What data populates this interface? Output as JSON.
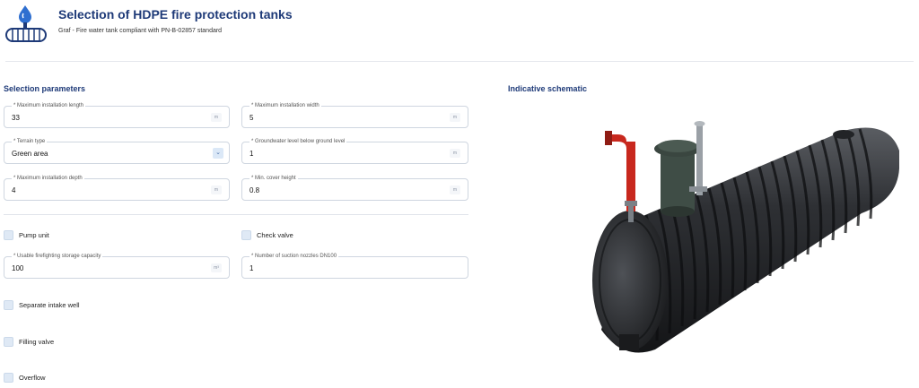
{
  "header": {
    "title": "Selection of HDPE fire protection tanks",
    "subtitle": "Graf - Fire water tank compliant with PN-B-02857 standard",
    "logo_icon": "tank-water-drop-icon"
  },
  "left": {
    "section_title": "Selection parameters",
    "fields": {
      "max_length": {
        "label": "* Maximum installation length",
        "value": "33",
        "unit": "m"
      },
      "max_width": {
        "label": "* Maximum installation width",
        "value": "5",
        "unit": "m"
      },
      "terrain": {
        "label": "* Terrain type",
        "value": "Green area",
        "icon": "chevron-down-icon"
      },
      "groundwater": {
        "label": "* Groundwater level below ground level",
        "value": "1",
        "unit": "m"
      },
      "max_depth": {
        "label": "* Maximum installation depth",
        "value": "4",
        "unit": "m"
      },
      "min_cover": {
        "label": "* Min. cover height",
        "value": "0.8",
        "unit": "m"
      },
      "capacity": {
        "label": "* Usable firefighting storage capacity",
        "value": "100",
        "unit": "m³"
      },
      "nozzles": {
        "label": "* Number of suction nozzles DN100",
        "value": "1"
      }
    },
    "checkboxes": {
      "pump_unit": "Pump unit",
      "check_valve": "Check valve",
      "intake_well": "Separate intake well",
      "filling_valve": "Filling valve",
      "overflow": "Overflow"
    }
  },
  "right": {
    "section_title": "Indicative schematic",
    "image_icon": "hdpe-tank-illustration"
  },
  "colors": {
    "brand_blue": "#1e3a78",
    "checkbox_fill": "#dfe9f5",
    "tank_body": "#2b2d30",
    "pipe_red": "#c8281e"
  }
}
